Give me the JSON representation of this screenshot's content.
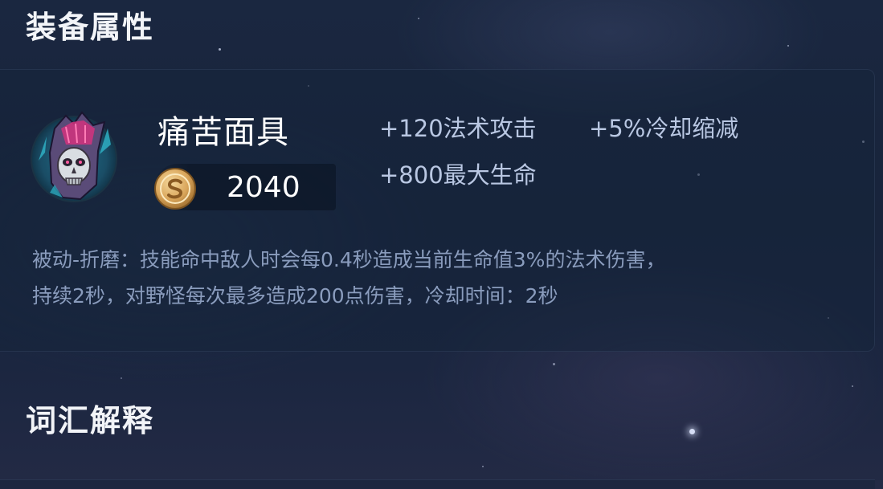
{
  "sections": {
    "equipment_title": "装备属性",
    "vocabulary_title": "词汇解释"
  },
  "item": {
    "name": "痛苦面具",
    "icon": "skull-mask-icon",
    "price": "2040",
    "price_icon": "gold-coin-icon",
    "stats": [
      "+120法术攻击",
      "+5%冷却缩减",
      "+800最大生命"
    ],
    "passive_lines": [
      "被动-折磨：技能命中敌人时会每0.4秒造成当前生命值3%的法术伤害，",
      "持续2秒，对野怪每次最多造成200点伤害，冷却时间：2秒"
    ]
  },
  "colors": {
    "background": "#18243b",
    "title": "#f2f4f8",
    "stat_text": "#b9c7e2",
    "description_text": "#8a9cbd",
    "coin_gold": "#d9a55a",
    "icon_teal": "#2fb5c9",
    "icon_magenta": "#d2327e"
  }
}
